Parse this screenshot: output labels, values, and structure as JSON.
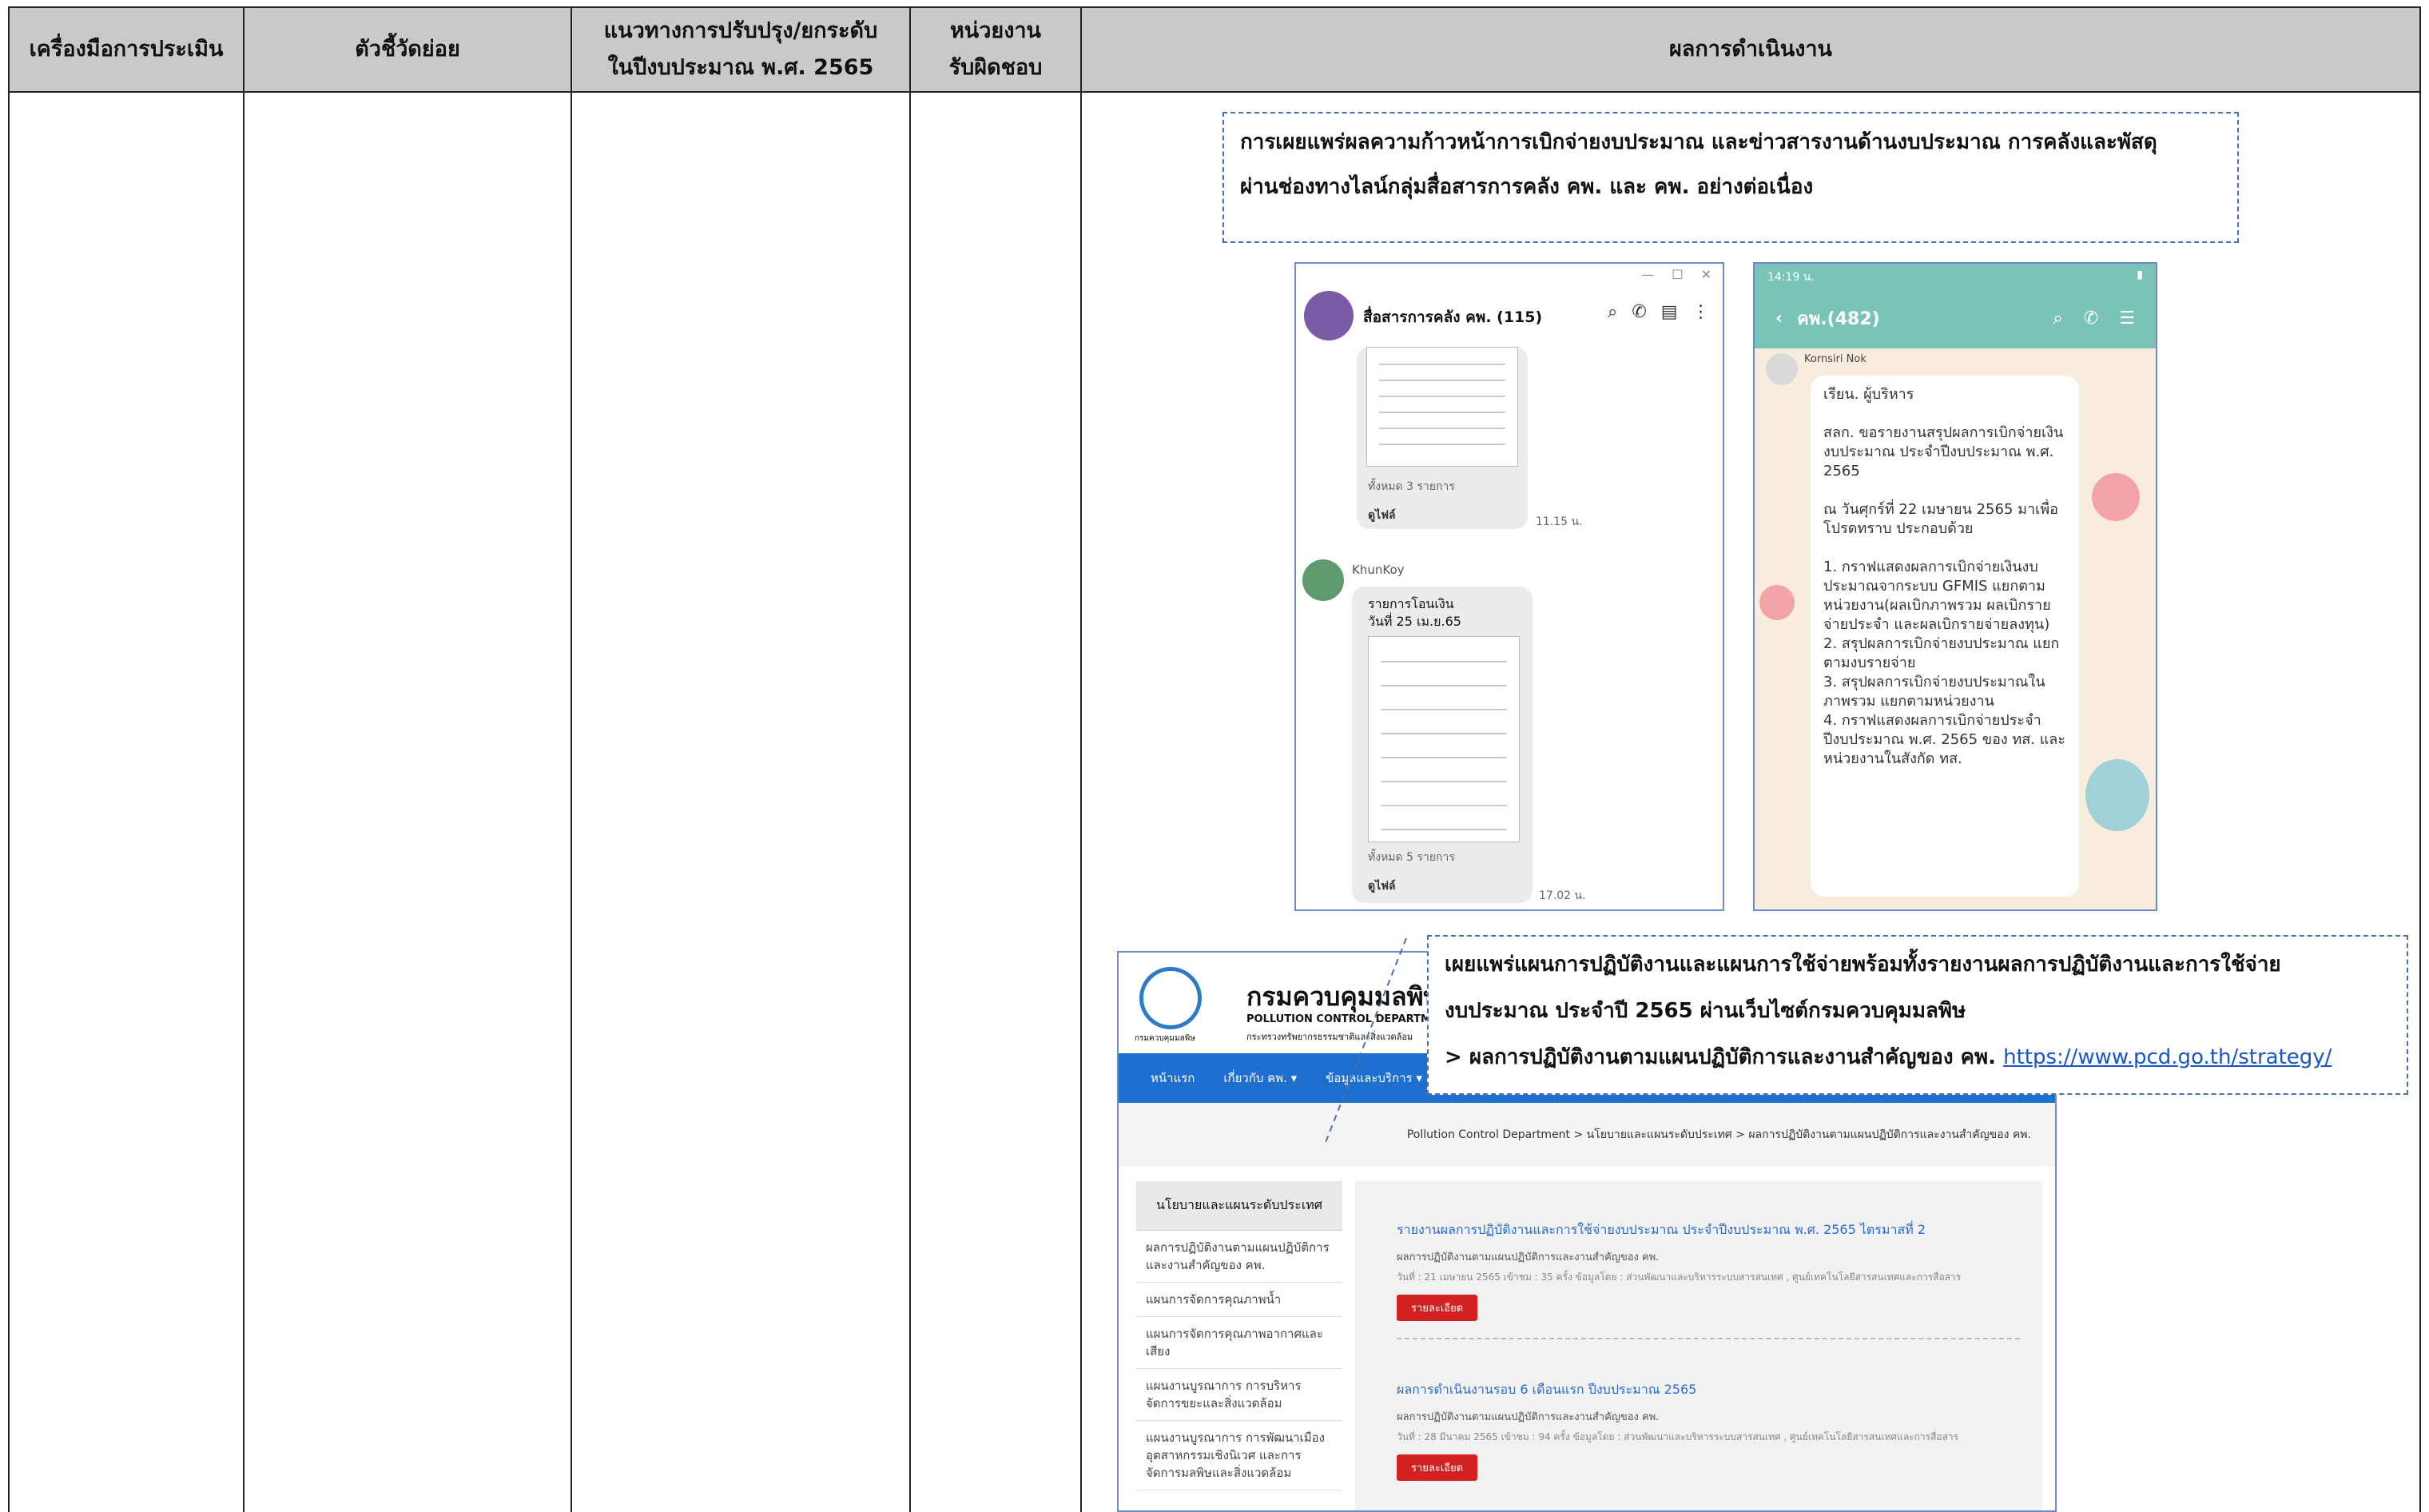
{
  "table": {
    "headers": [
      "เครื่องมือการประเมิน",
      "ตัวชี้วัดย่อย",
      "แนวทางการปรับปรุง/ยกระดับ\nในปีงบประมาณ พ.ศ. 2565",
      "หน่วยงาน\nรับผิดชอบ",
      "ผลการดำเนินงาน"
    ]
  },
  "callout1": {
    "line1": "การเผยแพร่ผลความก้าวหน้าการเบิกจ่ายงบประมาณ และข่าวสารงานด้านงบประมาณ การคลังและพัสดุ",
    "line2": "ผ่านช่องทางไลน์กลุ่มสื่อสารการคลัง คพ. และ คพ. อย่างต่อเนื่อง"
  },
  "line_desktop": {
    "group_name": "สื่อสารการคลัง คพ. (115)",
    "msg1": {
      "total": "ทั้งหมด 3 รายการ",
      "view": "ดูไฟล์",
      "time": "11.15 น."
    },
    "sender2": "KhunKoy",
    "msg2": {
      "title": "รายการโอนเงิน",
      "date": "วันที่ 25 เม.ย.65",
      "total": "ทั้งหมด 5 รายการ",
      "view": "ดูไฟล์",
      "time": "17.02 น."
    }
  },
  "line_mobile": {
    "status_time": "14:19 น.",
    "chat_title": "คพ.(482)",
    "sender": "Kornsiri Nok",
    "message": "เรียน. ผู้บริหาร\n\nสลก. ขอรายงานสรุปผลการเบิกจ่ายเงินงบประมาณ ประจำปีงบประมาณ พ.ศ. 2565\n\nณ วันศุกร์ที่ 22 เมษายน 2565 มาเพื่อโปรดทราบ ประกอบด้วย\n\n1. กราฟแสดงผลการเบิกจ่ายเงินงบประมาณจากระบบ GFMIS แยกตามหน่วยงาน(ผลเบิกภาพรวม ผลเบิกรายจ่ายประจำ และผลเบิกรายจ่ายลงทุน)\n2. สรุปผลการเบิกจ่ายงบประมาณ แยกตามงบรายจ่าย\n3. สรุปผลการเบิกจ่ายงบประมาณในภาพรวม แยกตามหน่วยงาน\n4. กราฟแสดงผลการเบิกจ่ายประจำปีงบประมาณ พ.ศ. 2565 ของ ทส. และหน่วยงานในสังกัด ทส."
  },
  "callout2": {
    "line1": "เผยแพร่แผนการปฏิบัติงานและแผนการใช้จ่ายพร้อมทั้งรายงานผลการปฏิบัติงานและการใช้จ่าย",
    "line2": "งบประมาณ ประจำปี 2565 ผ่านเว็บไซต์กรมควบคุมมลพิษ",
    "line3_prefix": "> ผลการปฏิบัติงานตามแผนปฏิบัติการและงานสำคัญของ คพ.",
    "link": "https://www.pcd.go.th/strategy/"
  },
  "website": {
    "org_th": "กรมควบคุมมลพิษ",
    "org_en": "POLLUTION CONTROL DEPARTMENT",
    "ministry": "กระทรวงทรัพยากรธรรมชาติและสิ่งแวดล้อม",
    "logo_caption": "กรมควบคุมมลพิษ",
    "nav": [
      "หน้าแรก",
      "เกี่ยวกับ คพ. ▾",
      "ข้อมูลและบริการ ▾"
    ],
    "breadcrumb": "Pollution Control Department > นโยบายและแผนระดับประเทศ > ผลการปฏิบัติงานตามแผนปฏิบัติการและงานสำคัญของ คพ.",
    "sidebar_title": "นโยบายและแผนระดับประเทศ",
    "sidebar_items": [
      "ผลการปฏิบัติงานตามแผนปฏิบัติการและงานสำคัญของ คพ.",
      "แผนการจัดการคุณภาพน้ำ",
      "แผนการจัดการคุณภาพอากาศและเสียง",
      "แผนงานบูรณาการ การบริหารจัดการขยะและสิ่งแวดล้อม",
      "แผนงานบูรณาการ การพัฒนาเมืองอุตสาหกรรมเชิงนิเวศ และการจัดการมลพิษและสิ่งแวดล้อม"
    ],
    "articles": [
      {
        "title": "รายงานผลการปฏิบัติงานและการใช้จ่ายงบประมาณ ประจำปีงบประมาณ พ.ศ. 2565 ไตรมาสที่ 2",
        "sub": "ผลการปฏิบัติงานตามแผนปฏิบัติการและงานสำคัญของ คพ.",
        "meta": "วันที่ : 21 เมษายน 2565   เข้าชม : 35 ครั้ง   ข้อมูลโดย : ส่วนพัฒนาและบริหารระบบสารสนเทศ , ศูนย์เทคโนโลยีสารสนเทศและการสื่อสาร",
        "button": "รายละเอียด"
      },
      {
        "title": "ผลการดำเนินงานรอบ 6 เดือนแรก ปีงบประมาณ 2565",
        "sub": "ผลการปฏิบัติงานตามแผนปฏิบัติการและงานสำคัญของ คพ.",
        "meta": "วันที่ : 28 มีนาคม 2565   เข้าชม : 94 ครั้ง   ข้อมูลโดย : ส่วนพัฒนาและบริหารระบบสารสนเทศ , ศูนย์เทคโนโลยีสารสนเทศและการสื่อสาร",
        "button": "รายละเอียด"
      }
    ]
  }
}
